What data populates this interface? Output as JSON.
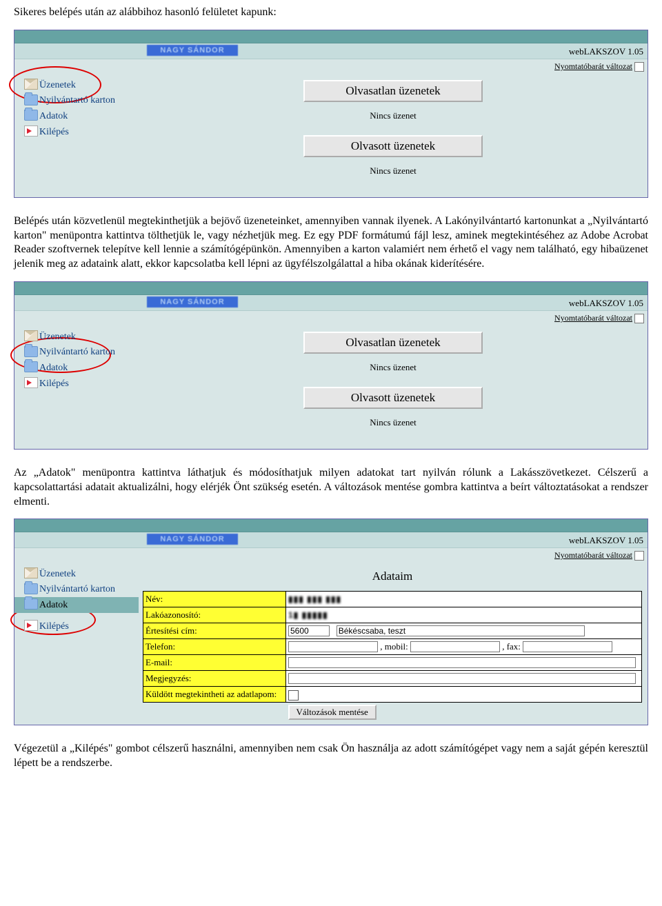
{
  "para1": "Sikeres belépés után az alábbihoz hasonló felületet kapunk:",
  "para2": "Belépés után közvetlenül megtekinthetjük a bejövő üzeneteinket, amennyiben vannak ilyenek. A Lakónyilvántartó kartonunkat a „Nyilvántartó karton\" menüpontra kattintva tölthetjük le, vagy nézhetjük meg. Ez egy PDF formátumú fájl lesz, aminek megtekintéséhez az Adobe Acrobat Reader szoftvernek telepítve kell lennie a számítógépünkön. Amennyiben a karton valamiért nem érhető el vagy nem található, egy hibaüzenet jelenik meg az adataink alatt, ekkor kapcsolatba kell lépni az ügyfélszolgálattal a hiba okának kiderítésére.",
  "para3": "Az „Adatok\" menüpontra kattintva láthatjuk és módosíthatjuk milyen adatokat tart nyilván rólunk a Lakásszövetkezet. Célszerű a kapcsolattartási adatait aktualizálni, hogy elérjék Önt szükség esetén. A változások mentése gombra kattintva a beírt változtatásokat a rendszer elmenti.",
  "para4": "Végezetül a „Kilépés\" gombot célszerű használni, amennyiben nem csak Ön használja az adott számítógépet vagy nem a saját gépén keresztül lépett be a rendszerbe.",
  "common": {
    "user_badge": "NAGY SÁNDOR",
    "app_title": "webLAKSZOV 1.05",
    "print_label": "Nyomtatóbarát változat",
    "sidebar": {
      "uzenetek": "Üzenetek",
      "nyilv": "Nyilvántartó karton",
      "adatok": "Adatok",
      "kilepes": "Kilépés"
    },
    "btn_unread": "Olvasatlan üzenetek",
    "btn_read": "Olvasott üzenetek",
    "no_msg": "Nincs üzenet"
  },
  "form": {
    "title": "Adataim",
    "rows": {
      "nev": {
        "label": "Név:",
        "value": "▮▮▮ ▮▮▮ ▮▮▮"
      },
      "lako": {
        "label": "Lakóazonosító:",
        "value": "1▮ ▮▮▮▮▮"
      },
      "ert": {
        "label": "Értesítési cím:",
        "zip": "5600",
        "city": "Békéscsaba, teszt"
      },
      "tel": {
        "label": "Telefon:",
        "t1": "",
        "mobil_lbl": ", mobil:",
        "t2": "",
        "fax_lbl": ", fax:",
        "t3": ""
      },
      "email": {
        "label": "E-mail:",
        "value": ""
      },
      "megj": {
        "label": "Megjegyzés:",
        "value": ""
      },
      "share": {
        "label": "Küldött megtekintheti az adatlapom:"
      }
    },
    "save_btn": "Változások mentése"
  }
}
